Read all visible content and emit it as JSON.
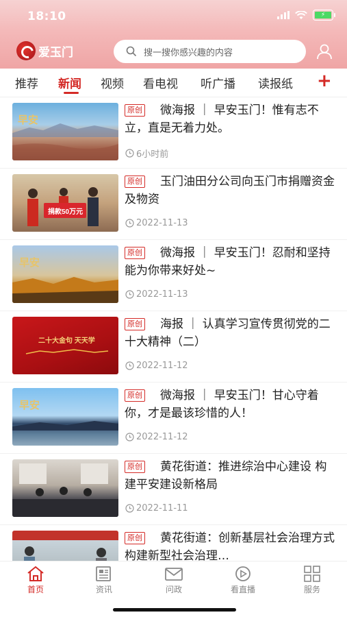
{
  "status_bar": {
    "time": "18:10"
  },
  "header": {
    "logo_text": "爱玉门",
    "search_placeholder": "搜一搜你感兴趣的内容"
  },
  "tabs": [
    {
      "label": "推荐",
      "active": false
    },
    {
      "label": "新闻",
      "active": true
    },
    {
      "label": "视频",
      "active": false
    },
    {
      "label": "看电视",
      "active": false
    },
    {
      "label": "听广播",
      "active": false
    },
    {
      "label": "读报纸",
      "active": false
    }
  ],
  "tab_add_label": "+",
  "news": [
    {
      "badge": "原创",
      "title": "微海报 ｜ 早安玉门！惟有志不立，直是无着力处。",
      "time": "6小时前",
      "thumb_text": "早安"
    },
    {
      "badge": "原创",
      "title": "玉门油田分公司向玉门市捐赠资金及物资",
      "time": "2022-11-13",
      "thumb_text": "捐款50万元"
    },
    {
      "badge": "原创",
      "title": "微海报 ｜ 早安玉门！忍耐和坚持能为你带来好处~",
      "time": "2022-11-13",
      "thumb_text": "早安"
    },
    {
      "badge": "原创",
      "title": "海报 ｜ 认真学习宣传贯彻党的二十大精神（二）",
      "time": "2022-11-12",
      "thumb_text": "二十大金句 天天学"
    },
    {
      "badge": "原创",
      "title": "微海报 ｜ 早安玉门！甘心守着你，才是最该珍惜的人！",
      "time": "2022-11-12",
      "thumb_text": "早安"
    },
    {
      "badge": "原创",
      "title": "黄花街道：推进综治中心建设 构建平安建设新格局",
      "time": "2022-11-11",
      "thumb_text": ""
    },
    {
      "badge": "原创",
      "title": "黄花街道：创新基层社会治理方式 构建新型社会治理…",
      "time": "",
      "thumb_text": ""
    }
  ],
  "bottom_nav": [
    {
      "label": "首页",
      "icon": "home-icon",
      "active": true
    },
    {
      "label": "资讯",
      "icon": "news-icon",
      "active": false
    },
    {
      "label": "问政",
      "icon": "mail-icon",
      "active": false
    },
    {
      "label": "看直播",
      "icon": "play-icon",
      "active": false
    },
    {
      "label": "服务",
      "icon": "grid-icon",
      "active": false
    }
  ],
  "colors": {
    "brand_red": "#d42a26",
    "header_pink": "#f4b9b9"
  }
}
